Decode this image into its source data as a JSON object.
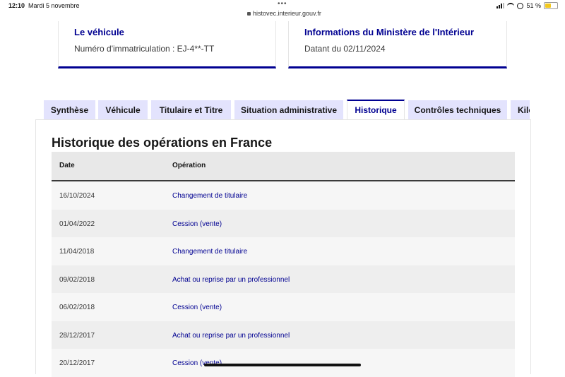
{
  "status_bar": {
    "time": "12:10",
    "date": "Mardi 5 novembre",
    "url": "histovec.interieur.gouv.fr",
    "battery": "51 %",
    "battery_level": 0.51
  },
  "cards": {
    "vehicle": {
      "title": "Le véhicule",
      "text": "Numéro d'immatriculation : EJ-4**-TT"
    },
    "ministry": {
      "title": "Informations du Ministère de l'Intérieur",
      "text": "Datant du 02/11/2024"
    }
  },
  "tabs": [
    {
      "label": "Synthèse",
      "active": false
    },
    {
      "label": "Véhicule",
      "active": false
    },
    {
      "label": "Titulaire et Titre",
      "active": false
    },
    {
      "label": "Situation administrative",
      "active": false
    },
    {
      "label": "Historique",
      "active": true
    },
    {
      "label": "Contrôles techniques",
      "active": false
    },
    {
      "label": "Kilométrage",
      "active": false
    }
  ],
  "history": {
    "title": "Historique des opérations en France",
    "columns": {
      "date": "Date",
      "operation": "Opération"
    },
    "rows": [
      {
        "date": "16/10/2024",
        "operation": "Changement de titulaire"
      },
      {
        "date": "01/04/2022",
        "operation": "Cession (vente)"
      },
      {
        "date": "11/04/2018",
        "operation": "Changement de titulaire"
      },
      {
        "date": "09/02/2018",
        "operation": "Achat ou reprise par un professionnel"
      },
      {
        "date": "06/02/2018",
        "operation": "Cession (vente)"
      },
      {
        "date": "28/12/2017",
        "operation": "Achat ou reprise par un professionnel"
      },
      {
        "date": "20/12/2017",
        "operation": "Cession (vente)"
      }
    ]
  },
  "colors": {
    "accent": "#000091",
    "tab_bg": "#e3e3fd",
    "battery": "#f2c81e"
  }
}
